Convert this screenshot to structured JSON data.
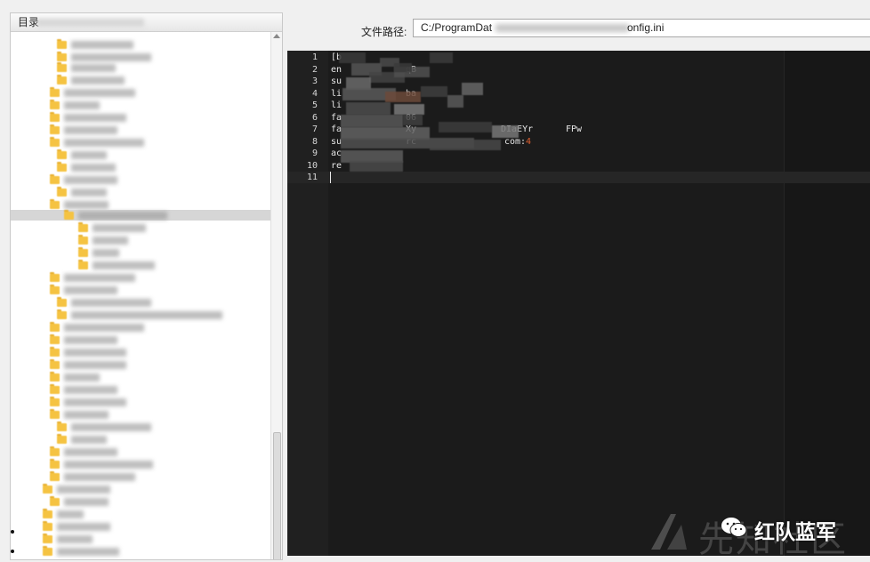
{
  "tree_panel": {
    "header_title": "目录"
  },
  "path_bar": {
    "label": "文件路径:",
    "value_start": "C:/ProgramDat",
    "value_end": "onfig.ini"
  },
  "editor": {
    "lines": [
      {
        "num": "1",
        "start": "[b",
        "end": ""
      },
      {
        "num": "2",
        "start": "en",
        "end": "qB"
      },
      {
        "num": "3",
        "start": "su",
        "end": ""
      },
      {
        "num": "4",
        "start": "li",
        "end": "ba"
      },
      {
        "num": "5",
        "start": "li",
        "end": ""
      },
      {
        "num": "6",
        "start": "fa",
        "end": "06"
      },
      {
        "num": "7",
        "start": "fa",
        "end": "Xy",
        "mid": "DIaEYr",
        "tail": "FPw"
      },
      {
        "num": "8",
        "start": "su",
        "end": "rc",
        "mid": "com:",
        "tail": "4"
      },
      {
        "num": "9",
        "start": "ac",
        "end": ""
      },
      {
        "num": "10",
        "start": "re",
        "end": ""
      },
      {
        "num": "11",
        "start": "",
        "end": ""
      }
    ]
  },
  "watermark": {
    "text": "红队蓝军",
    "bg_text": "先知社区"
  },
  "colors": {
    "editor_bg": "#1b1b1b",
    "folder": "#f5c342",
    "highlight": "#e06030"
  }
}
